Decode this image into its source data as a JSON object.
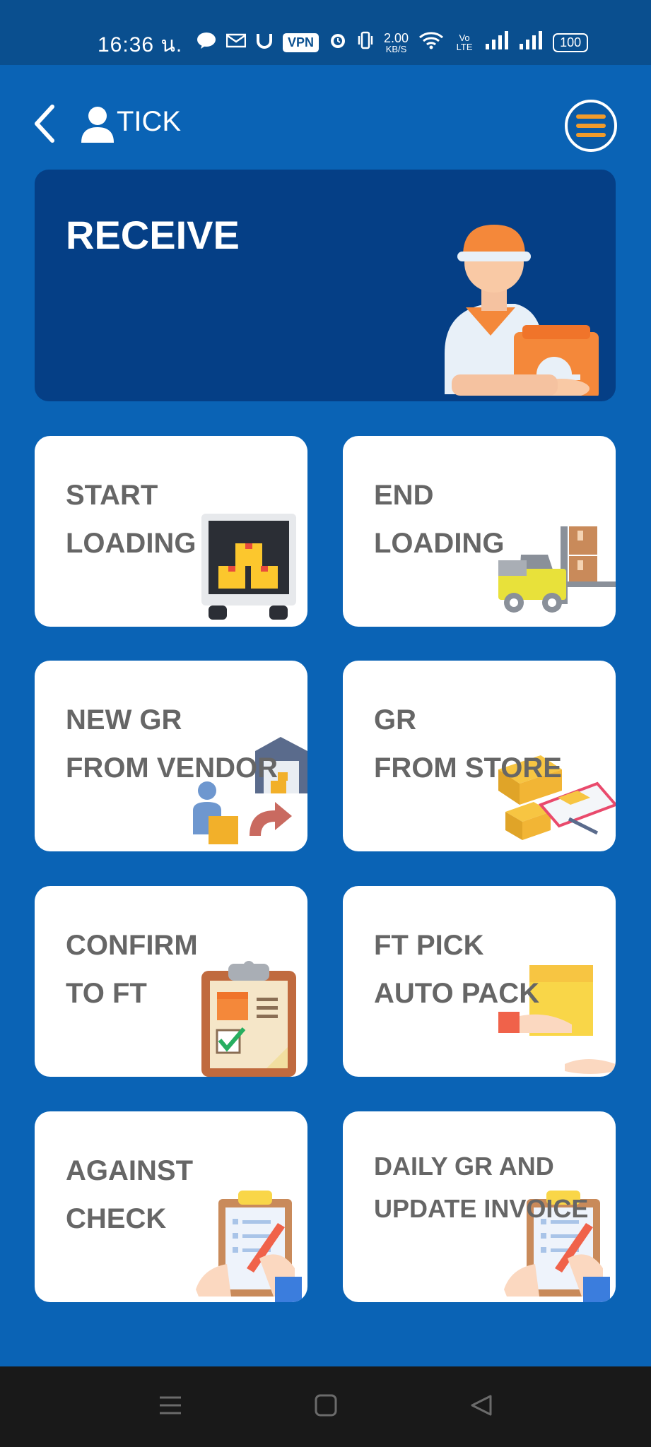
{
  "status_bar": {
    "time": "16:36 น.",
    "icons": [
      "line-icon",
      "mail-icon",
      "magnet-icon",
      "vpn-badge",
      "alarm-icon",
      "vibrate-icon",
      "network-speed",
      "wifi-icon",
      "volte-icon",
      "signal-icon",
      "signal-icon",
      "battery-icon"
    ],
    "vpn_label": "VPN",
    "net_speed": "2.00",
    "net_unit": "KB/S",
    "volte": "Vo LTE",
    "battery": "100"
  },
  "header": {
    "title": "TICK",
    "icons": [
      "back-icon",
      "user-icon",
      "menu-icon"
    ]
  },
  "banner": {
    "title": "RECEIVE",
    "icon": "delivery-man-illustration"
  },
  "tiles": [
    {
      "line1": "START",
      "line2": "LOADING",
      "icon": "truck-boxes-illustration"
    },
    {
      "line1": "END",
      "line2": "LOADING",
      "icon": "forklift-illustration"
    },
    {
      "line1": "NEW GR",
      "line2": "FROM VENDOR",
      "icon": "warehouse-transfer-illustration"
    },
    {
      "line1": "GR",
      "line2": "FROM STORE",
      "icon": "boxes-checklist-illustration"
    },
    {
      "line1": "CONFIRM",
      "line2": "TO FT",
      "icon": "clipboard-check-illustration"
    },
    {
      "line1": "FT PICK",
      "line2": "AUTO PACK",
      "icon": "hands-box-illustration"
    },
    {
      "line1": "AGAINST",
      "line2": "CHECK",
      "icon": "clipboard-writing-illustration"
    },
    {
      "line1": "DAILY GR AND",
      "line2": "UPDATE INVOICE",
      "icon": "clipboard-writing-illustration"
    }
  ],
  "colors": {
    "background": "#0a63b5",
    "status_bar": "#0a4f8f",
    "banner": "#053f86",
    "card": "#ffffff",
    "card_text": "#666666",
    "accent": "#f29b2a",
    "nav_bar": "#191919"
  },
  "nav_bar": {
    "icons": [
      "recent-apps-icon",
      "home-icon",
      "back-triangle-icon"
    ]
  }
}
